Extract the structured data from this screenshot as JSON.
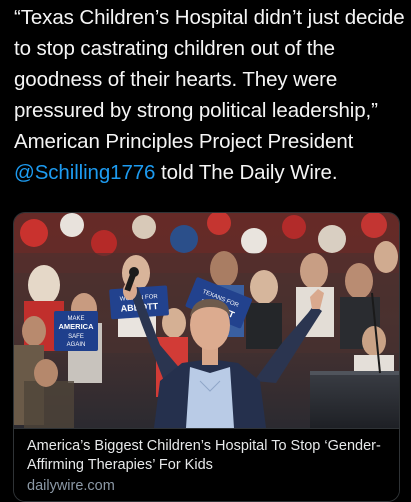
{
  "tweet": {
    "text_part1": "“Texas Children’s Hospital didn’t just decide to stop castrating children out of the goodness of their hearts. They were pressured by strong political leadership,” American Principles Project President ",
    "mention": "@Schilling1776",
    "text_part2": " told The Daily Wire."
  },
  "card": {
    "title": "America’s Biggest Children’s Hospital To Stop ‘Gender-Affirming Therapies’ For Kids",
    "domain": "dailywire.com",
    "image_signs": {
      "sign_left_line1": "MAKE",
      "sign_left_line2": "AMERICA",
      "sign_left_line3": "SAFE",
      "sign_left_line4": "AGAIN",
      "sign_mid_line1": "WOMEN FOR",
      "sign_mid_line2": "ABBOTT",
      "sign_right_line1": "TEXANS FOR",
      "sign_right_line2": "ABBOTT"
    }
  },
  "colors": {
    "background": "#000000",
    "text": "#f5f5f5",
    "mention": "#1d9bf0",
    "card_border": "#2f3336",
    "domain": "#8b98a5"
  }
}
